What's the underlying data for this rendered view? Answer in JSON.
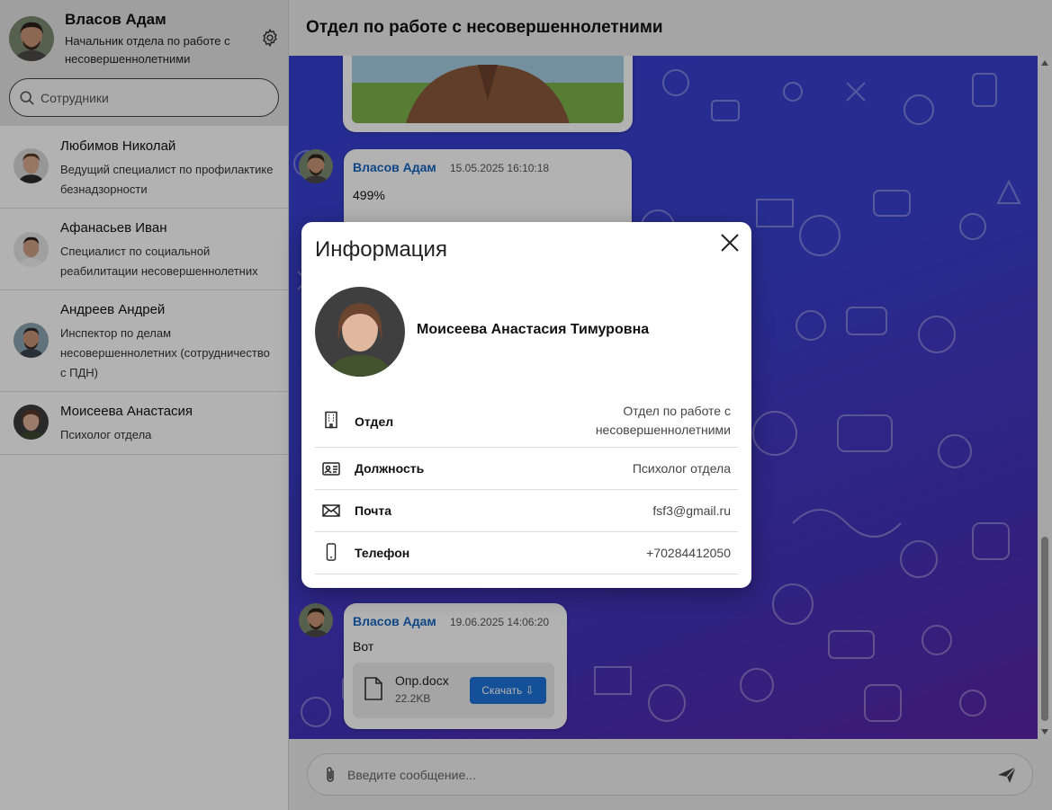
{
  "current_user": {
    "name": "Власов Адам",
    "role": "Начальник отдела по работе с несовершеннолетними"
  },
  "search": {
    "placeholder": "Сотрудники"
  },
  "contacts": [
    {
      "name": "Любимов Николай",
      "role": "Ведущий специалист по профилактике безнадзорности"
    },
    {
      "name": "Афанасьев Иван",
      "role": "Специалист по социальной реабилитации несовершеннолетних"
    },
    {
      "name": "Андреев Андрей",
      "role": "Инспектор по делам несовершеннолетних (сотрудничество с ПДН)"
    },
    {
      "name": "Моисеева Анастасия",
      "role": "Психолог отдела"
    }
  ],
  "chat": {
    "title": "Отдел по работе с несовершеннолетними",
    "messages": [
      {
        "author": "Власов Адам",
        "time": "15.05.2025 16:10:18",
        "text": "499%"
      },
      {
        "author": "Власов Адам",
        "time": "19.06.2025 14:06:20",
        "text": "Вот",
        "file": {
          "name": "Опр.docx",
          "size": "22.2KB",
          "download_label": "Скачать"
        }
      }
    ],
    "input_placeholder": "Введите сообщение..."
  },
  "modal": {
    "title": "Информация",
    "person_name": "Моисеева Анастасия Тимуровна",
    "rows": [
      {
        "icon": "building-icon",
        "label": "Отдел",
        "value": "Отдел по работе с несовершеннолетними"
      },
      {
        "icon": "id-card-icon",
        "label": "Должность",
        "value": "Психолог отдела"
      },
      {
        "icon": "envelope-icon",
        "label": "Почта",
        "value": "fsf3@gmail.ru"
      },
      {
        "icon": "phone-icon",
        "label": "Телефон",
        "value": "+70284412050"
      }
    ]
  },
  "colors": {
    "accent": "#1e73d8",
    "author": "#1565c0",
    "chat_background_start": "#3540d0",
    "chat_background_end": "#5a25a8"
  }
}
